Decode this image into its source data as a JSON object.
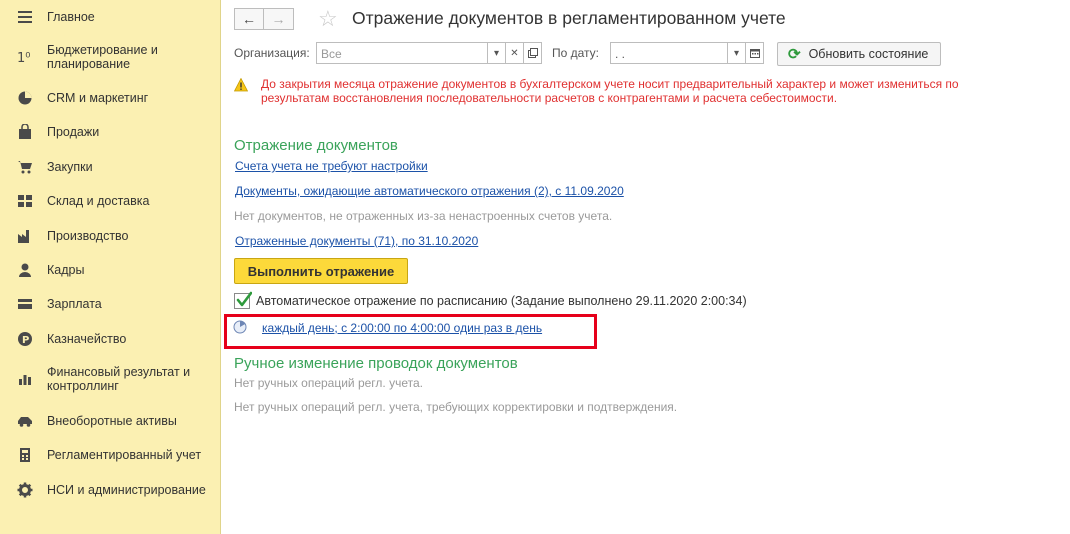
{
  "sidebar": {
    "items": [
      {
        "label": "Главное",
        "icon": "menu-icon"
      },
      {
        "label": "Бюджетирование и планирование",
        "icon": "budget-icon"
      },
      {
        "label": "CRM и маркетинг",
        "icon": "crm-icon"
      },
      {
        "label": "Продажи",
        "icon": "sales-bag-icon"
      },
      {
        "label": "Закупки",
        "icon": "cart-icon"
      },
      {
        "label": "Склад и доставка",
        "icon": "warehouse-icon"
      },
      {
        "label": "Производство",
        "icon": "factory-icon"
      },
      {
        "label": "Кадры",
        "icon": "person-icon"
      },
      {
        "label": "Зарплата",
        "icon": "wallet-icon"
      },
      {
        "label": "Казначейство",
        "icon": "coin-icon"
      },
      {
        "label": "Финансовый результат и контроллинг",
        "icon": "bar-chart-icon"
      },
      {
        "label": "Внеоборотные активы",
        "icon": "car-icon"
      },
      {
        "label": "Регламентированный учет",
        "icon": "calculator-icon"
      },
      {
        "label": "НСИ и администрирование",
        "icon": "gear-icon"
      }
    ]
  },
  "header": {
    "back_label": "←",
    "forward_label": "→",
    "star": "☆",
    "title": "Отражение документов в регламентированном учете"
  },
  "filters": {
    "org_label": "Организация:",
    "org_value": "Все",
    "date_label": "По дату:",
    "date_value": ". .",
    "refresh_label": "Обновить состояние"
  },
  "warning": {
    "text": "До закрытия месяца отражение документов в бухгалтерском учете носит предварительный характер и может измениться по результатам восстановления последовательности расчетов с контрагентами и расчета себестоимости."
  },
  "reflection": {
    "title": "Отражение документов",
    "link_accounts": "Счета учета не требуют настройки",
    "link_pending": "Документы, ожидающие автоматического отражения (2), с 11.09.2020",
    "no_unreflected": "Нет документов, не отраженных из-за ненастроенных счетов учета.",
    "link_reflected": "Отраженные документы (71), по 31.10.2020",
    "execute_label": "Выполнить отражение",
    "auto_label": "Автоматическое отражение по расписанию (Задание выполнено 29.11.2020 2:00:34)",
    "auto_checked": true,
    "schedule_link": "каждый день; с 2:00:00 по 4:00:00 один раз в день"
  },
  "manual": {
    "title": "Ручное изменение проводок документов",
    "no_ops": "Нет ручных операций регл. учета.",
    "no_ops_correction": "Нет ручных операций регл. учета, требующих корректировки и подтверждения."
  },
  "colors": {
    "sidebar_bg": "#fbf0b2",
    "section_green": "#3aa35a",
    "link_blue": "#1c52a8",
    "warning_red": "#e03030",
    "button_yellow": "#fcd93a",
    "highlight_red": "#e6001a"
  }
}
